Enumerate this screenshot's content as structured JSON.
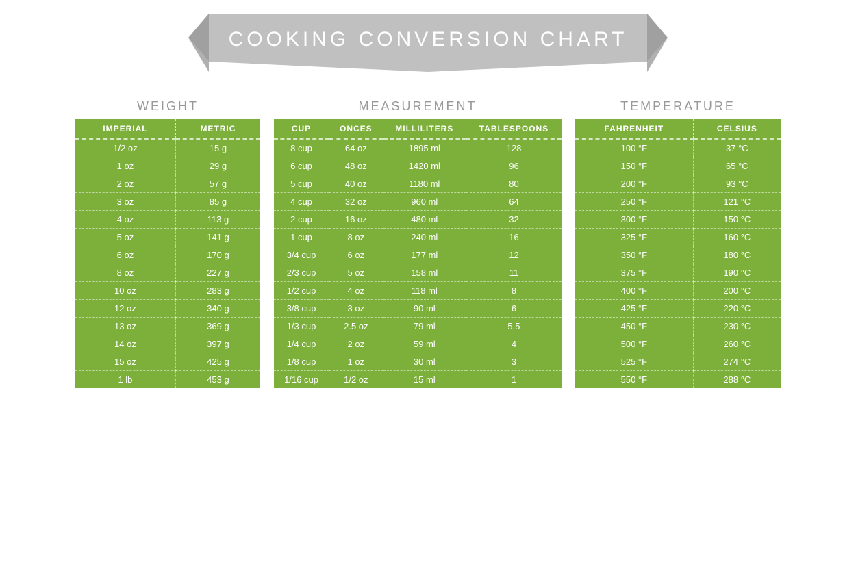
{
  "banner": {
    "title": "COOKING CONVERSION CHART"
  },
  "weight": {
    "section_title": "WEIGHT",
    "col1": "IMPERIAL",
    "col2": "METRIC",
    "rows": [
      [
        "1/2 oz",
        "15 g"
      ],
      [
        "1 oz",
        "29 g"
      ],
      [
        "2 oz",
        "57 g"
      ],
      [
        "3 oz",
        "85 g"
      ],
      [
        "4 oz",
        "113 g"
      ],
      [
        "5 oz",
        "141 g"
      ],
      [
        "6 oz",
        "170 g"
      ],
      [
        "8 oz",
        "227 g"
      ],
      [
        "10 oz",
        "283 g"
      ],
      [
        "12 oz",
        "340 g"
      ],
      [
        "13 oz",
        "369 g"
      ],
      [
        "14 oz",
        "397 g"
      ],
      [
        "15 oz",
        "425 g"
      ],
      [
        "1 lb",
        "453 g"
      ]
    ]
  },
  "measurement": {
    "section_title": "MEASUREMENT",
    "col1": "CUP",
    "col2": "ONCES",
    "col3": "MILLILITERS",
    "col4": "TABLESPOONS",
    "rows": [
      [
        "8 cup",
        "64 oz",
        "1895 ml",
        "128"
      ],
      [
        "6 cup",
        "48 oz",
        "1420 ml",
        "96"
      ],
      [
        "5 cup",
        "40 oz",
        "1180 ml",
        "80"
      ],
      [
        "4 cup",
        "32 oz",
        "960 ml",
        "64"
      ],
      [
        "2 cup",
        "16 oz",
        "480 ml",
        "32"
      ],
      [
        "1 cup",
        "8 oz",
        "240 ml",
        "16"
      ],
      [
        "3/4 cup",
        "6 oz",
        "177 ml",
        "12"
      ],
      [
        "2/3 cup",
        "5 oz",
        "158 ml",
        "11"
      ],
      [
        "1/2 cup",
        "4 oz",
        "118 ml",
        "8"
      ],
      [
        "3/8 cup",
        "3 oz",
        "90 ml",
        "6"
      ],
      [
        "1/3 cup",
        "2.5 oz",
        "79 ml",
        "5.5"
      ],
      [
        "1/4 cup",
        "2 oz",
        "59 ml",
        "4"
      ],
      [
        "1/8 cup",
        "1 oz",
        "30 ml",
        "3"
      ],
      [
        "1/16 cup",
        "1/2 oz",
        "15 ml",
        "1"
      ]
    ]
  },
  "temperature": {
    "section_title": "TEMPERATURE",
    "col1": "FAHRENHEIT",
    "col2": "CELSIUS",
    "rows": [
      [
        "100 °F",
        "37 °C"
      ],
      [
        "150 °F",
        "65 °C"
      ],
      [
        "200 °F",
        "93 °C"
      ],
      [
        "250 °F",
        "121 °C"
      ],
      [
        "300 °F",
        "150 °C"
      ],
      [
        "325 °F",
        "160 °C"
      ],
      [
        "350 °F",
        "180 °C"
      ],
      [
        "375 °F",
        "190 °C"
      ],
      [
        "400 °F",
        "200 °C"
      ],
      [
        "425 °F",
        "220 °C"
      ],
      [
        "450 °F",
        "230 °C"
      ],
      [
        "500 °F",
        "260 °C"
      ],
      [
        "525 °F",
        "274 °C"
      ],
      [
        "550 °F",
        "288 °C"
      ]
    ]
  }
}
